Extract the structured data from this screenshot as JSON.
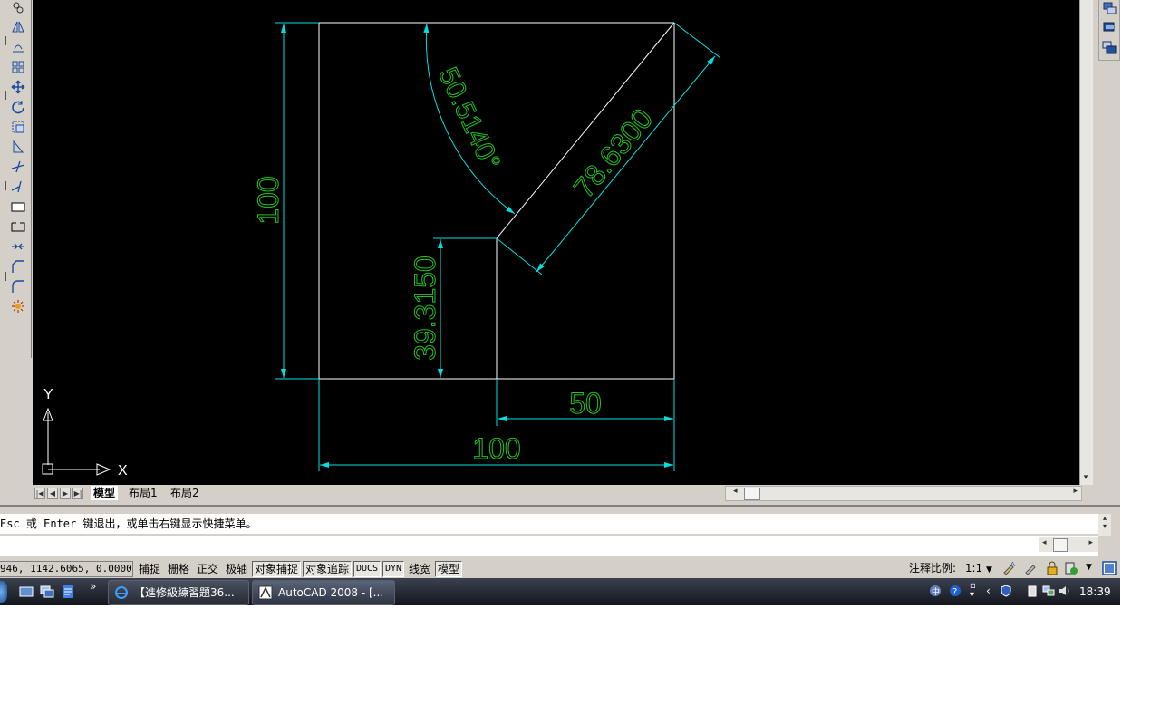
{
  "app": {
    "title": "AutoCAD 2008"
  },
  "drawing": {
    "dimensions": {
      "overall_height": "100",
      "angle": "50.5140°",
      "diagonal_length": "78.6300",
      "inner_height": "39.3150",
      "inner_width": "50",
      "overall_width": "100"
    },
    "ucs": {
      "x_label": "X",
      "y_label": "Y"
    },
    "colors": {
      "background": "#000000",
      "geometry": "#ffffff",
      "dimension": "#00e0e0",
      "dimension_text": "#22c022"
    }
  },
  "layout_tabs": [
    {
      "label": "模型",
      "active": true
    },
    {
      "label": "布局1",
      "active": false
    },
    {
      "label": "布局2",
      "active": false
    }
  ],
  "command": {
    "line1": "Esc 或 Enter 键退出，或单击右键显示快捷菜单。"
  },
  "status_bar": {
    "coordinates": "946, 1142.6065, 0.0000",
    "buttons": [
      {
        "label": "捕捉",
        "on": false
      },
      {
        "label": "栅格",
        "on": false
      },
      {
        "label": "正交",
        "on": false
      },
      {
        "label": "极轴",
        "on": false
      },
      {
        "label": "对象捕捉",
        "on": true
      },
      {
        "label": "对象追踪",
        "on": true
      },
      {
        "label": "DUCS",
        "on": true
      },
      {
        "label": "DYN",
        "on": true
      },
      {
        "label": "线宽",
        "on": false
      },
      {
        "label": "模型",
        "on": true
      }
    ],
    "annotation_scale_label": "注释比例:",
    "annotation_scale_value": "1:1"
  },
  "taskbar": {
    "tasks": [
      {
        "label": "【進修級練習題36...",
        "icon": "ie-icon"
      },
      {
        "label": "AutoCAD 2008 - [...",
        "icon": "autocad-icon"
      }
    ],
    "more_label": "»",
    "clock": "18:39"
  }
}
